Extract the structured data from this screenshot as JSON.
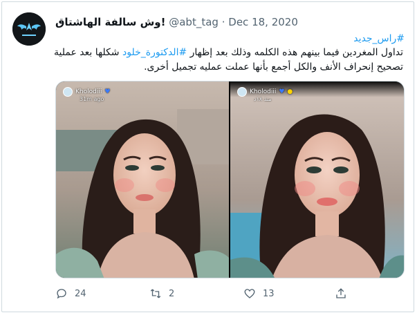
{
  "tweet": {
    "author_name": "وش سالفة الهاشتاق!",
    "author_handle": "@abt_tag",
    "separator": "·",
    "date": "Dec 18, 2020",
    "hashtag": "#راس_جديد",
    "text_part1": "تداول المغردين فيما بينهم هذه الكلمه وذلك بعد إظهار",
    "mention_tag": "#الدكتورة_خلود",
    "text_part2": "شكلها بعد عملية تصحيح إنحراف الأنف والكل أجمع بأنها عملت عمليه تجميل أخرى."
  },
  "media": {
    "left_overlay_name": "Kholodiii",
    "left_overlay_time": "31m ago",
    "right_overlay_name": "Kholodiii",
    "right_overlay_time": "منذ ١٨د"
  },
  "actions": {
    "reply_count": "24",
    "retweet_count": "2",
    "like_count": "13"
  },
  "colors": {
    "link": "#1d9bf0",
    "text": "#0f1419",
    "secondary": "#536471",
    "border": "#cfd9de"
  }
}
